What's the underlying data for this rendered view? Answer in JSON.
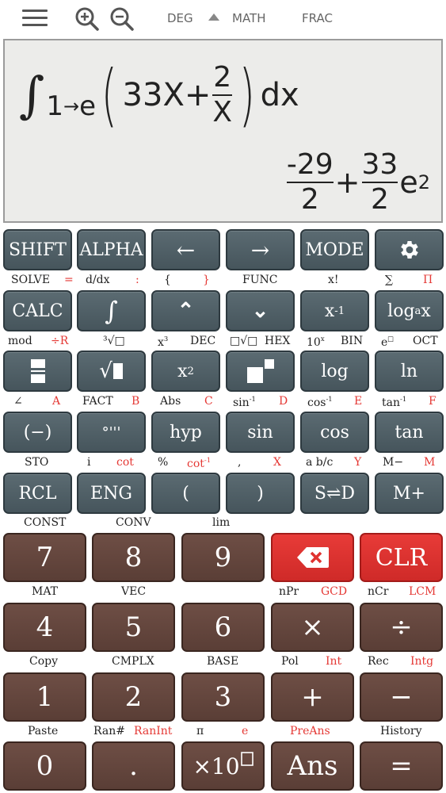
{
  "topbar": {
    "angle_mode": "DEG",
    "input_mode": "MATH",
    "output_mode": "FRAC"
  },
  "display": {
    "integral_symbol": "∫",
    "lower_limit": "1",
    "arrow": "→",
    "upper_limit": "e",
    "open_paren": "(",
    "term1": "33X+",
    "frac_num": "2",
    "frac_den": "X",
    "close_paren": ")",
    "differential": "dx",
    "result_frac1_num": "-29",
    "result_frac1_den": "2",
    "result_plus": "+",
    "result_frac2_num": "33",
    "result_frac2_den": "2",
    "result_base": "e",
    "result_exp": "2"
  },
  "row1": {
    "shift": "SHIFT",
    "alpha": "ALPHA",
    "left": "←",
    "right": "→",
    "mode": "MODE"
  },
  "row1_labels": [
    "SOLVE",
    "=",
    "d/dx",
    ":",
    "{",
    "}",
    "FUNC",
    "x!",
    "∑",
    "Π"
  ],
  "row2": {
    "calc": "CALC",
    "integral": "∫",
    "up": "⌃",
    "down": "⌄",
    "xinv": "x",
    "xinv_sup": "-1",
    "log_a": "log",
    "log_a_sub": "a",
    "log_a_x": "x"
  },
  "row2_labels": [
    "mod",
    "÷R",
    "³√□",
    "x",
    "3",
    "DEC",
    "□√□",
    "HEX",
    "10",
    "x",
    "BIN",
    "e",
    "□",
    "OCT"
  ],
  "row3": {
    "sqrt": "√",
    "x2": "x",
    "x2_sup": "2",
    "log": "log",
    "ln": "ln"
  },
  "row3_labels": [
    "∠",
    "A",
    "FACT",
    "B",
    "Abs",
    "C",
    "sin",
    "-1",
    "D",
    "cos",
    "-1",
    "E",
    "tan",
    "-1",
    "F"
  ],
  "row4": {
    "neg": "(−)",
    "dms": "°'''",
    "hyp": "hyp",
    "sin": "sin",
    "cos": "cos",
    "tan": "tan"
  },
  "row4_labels": [
    "STO",
    "i",
    "cot",
    "%",
    "cot",
    "-1",
    ",",
    "X",
    "a b/c",
    "Y",
    "M−",
    "M"
  ],
  "row5": {
    "rcl": "RCL",
    "eng": "ENG",
    "lparen": "(",
    "rparen": ")",
    "sd": "S⇌D",
    "mplus": "M+"
  },
  "row5_labels": [
    "CONST",
    "CONV",
    "lim"
  ],
  "row6": {
    "seven": "7",
    "eight": "8",
    "nine": "9",
    "clr": "CLR"
  },
  "row6_labels": [
    "MAT",
    "VEC",
    "nPr",
    "GCD",
    "nCr",
    "LCM"
  ],
  "row7": {
    "four": "4",
    "five": "5",
    "six": "6",
    "times": "×",
    "divide": "÷"
  },
  "row7_labels": [
    "Copy",
    "CMPLX",
    "BASE",
    "Pol",
    "Int",
    "Rec",
    "Intg"
  ],
  "row8": {
    "one": "1",
    "two": "2",
    "three": "3",
    "plus": "+",
    "minus": "−"
  },
  "row8_labels": [
    "Paste",
    "Ran#",
    "RanInt",
    "π",
    "e",
    "PreAns",
    "History"
  ],
  "row9": {
    "zero": "0",
    "dot": ".",
    "x10": "×10",
    "ans": "Ans",
    "equals": "="
  },
  "colors": {
    "dark_key": "#4f5f66",
    "brown_key": "#64463e",
    "red_key": "#e0322f",
    "alt_label_red": "#e53935",
    "display_bg": "#ececea"
  }
}
